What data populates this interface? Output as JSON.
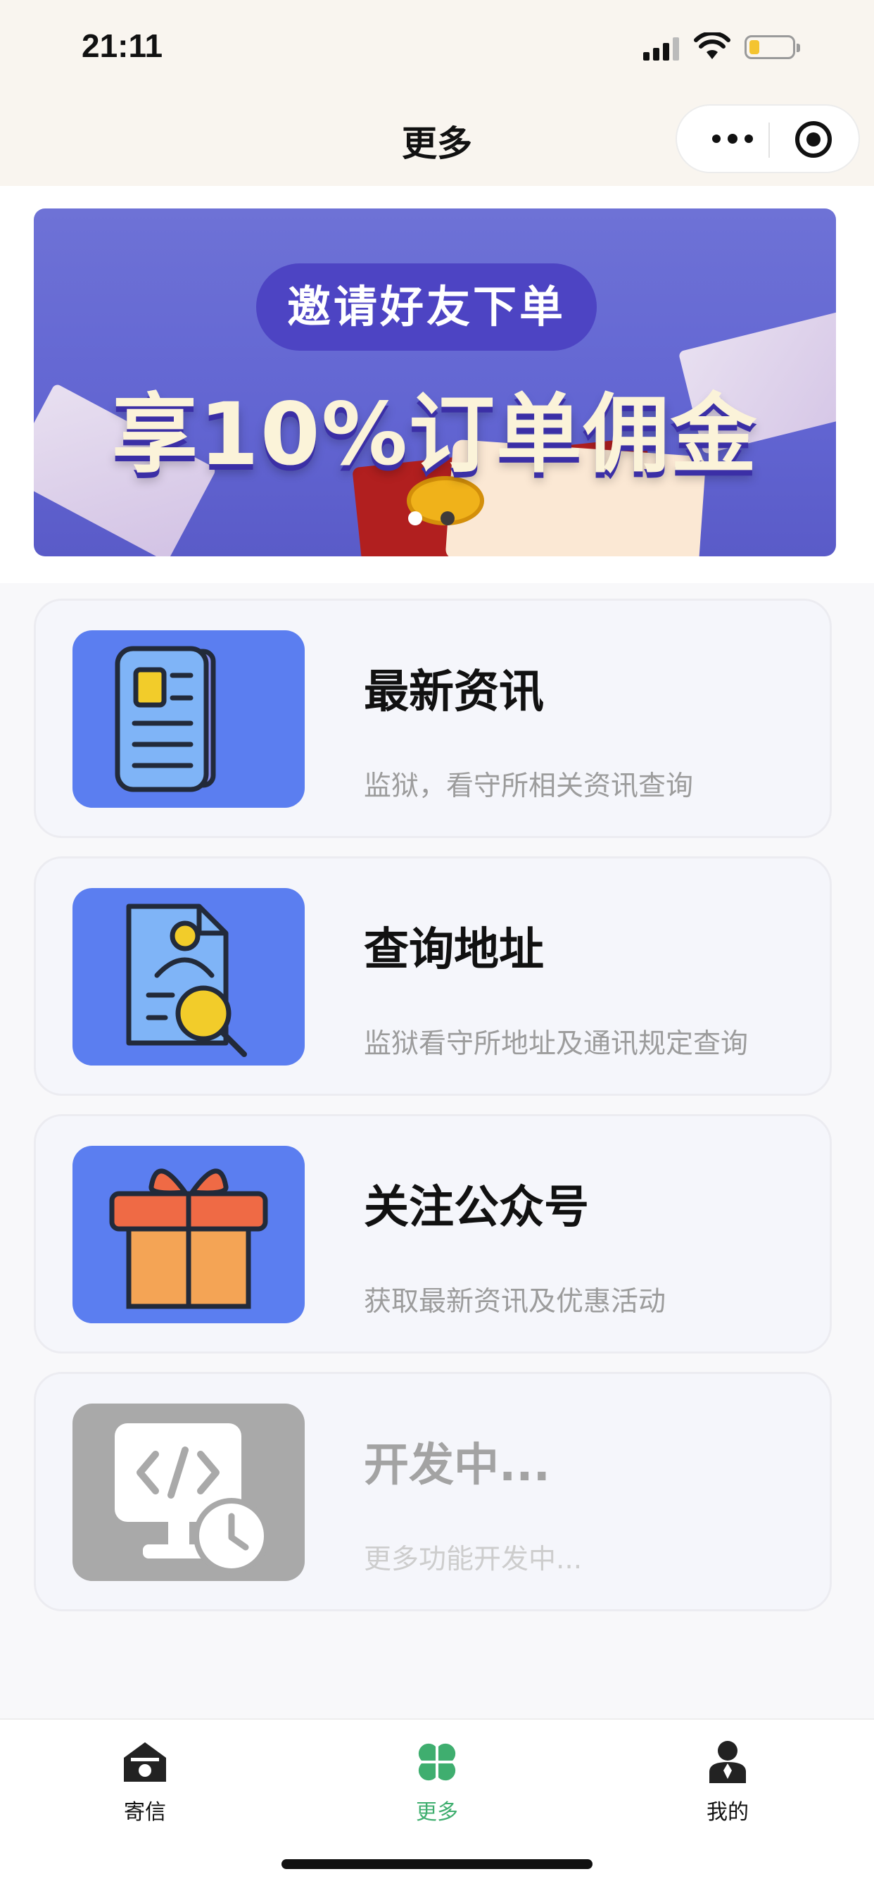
{
  "status_bar": {
    "time": "21:11"
  },
  "nav": {
    "title": "更多"
  },
  "banner": {
    "pill_text": "邀请好友下单",
    "headline": "享10%订单佣金",
    "dot_colors": [
      "#ffffff",
      "#3e3a3a"
    ]
  },
  "cards": [
    {
      "title": "最新资讯",
      "subtitle": "监狱，看守所相关资讯查询",
      "icon": "newspaper-icon"
    },
    {
      "title": "查询地址",
      "subtitle": "监狱看守所地址及通讯规定查询",
      "icon": "document-search-icon"
    },
    {
      "title": "关注公众号",
      "subtitle": "获取最新资讯及优惠活动",
      "icon": "gift-box-icon"
    },
    {
      "title": "开发中...",
      "subtitle": "更多功能开发中...",
      "icon": "code-clock-icon"
    }
  ],
  "tabbar": {
    "items": [
      {
        "label": "寄信",
        "icon": "house-icon"
      },
      {
        "label": "更多",
        "icon": "clover-icon"
      },
      {
        "label": "我的",
        "icon": "person-icon"
      }
    ],
    "active_index": 1
  },
  "colors": {
    "accent_green": "#3fae6f",
    "card_thumb_blue": "#5b7ef0",
    "banner_purple": "#6265d2"
  }
}
